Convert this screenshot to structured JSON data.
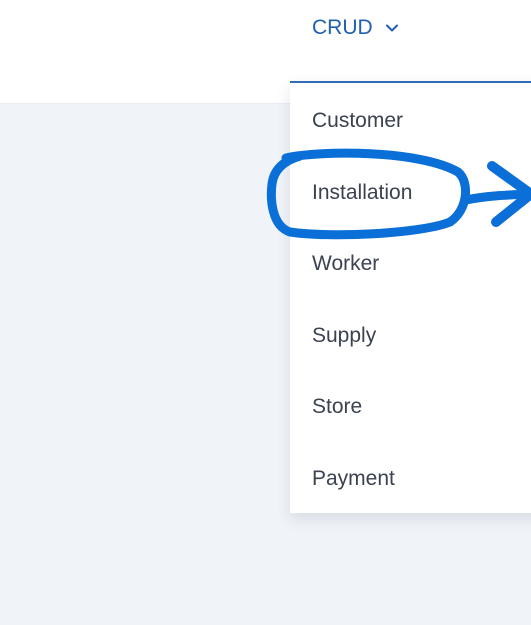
{
  "navbar": {
    "crud_label": "CRUD",
    "chevron_icon": "chevron-down-icon"
  },
  "dropdown": {
    "items": [
      {
        "label": "Customer"
      },
      {
        "label": "Installation"
      },
      {
        "label": "Worker"
      },
      {
        "label": "Supply"
      },
      {
        "label": "Store"
      },
      {
        "label": "Payment"
      }
    ]
  },
  "annotation": {
    "color": "#0a6fd6"
  }
}
